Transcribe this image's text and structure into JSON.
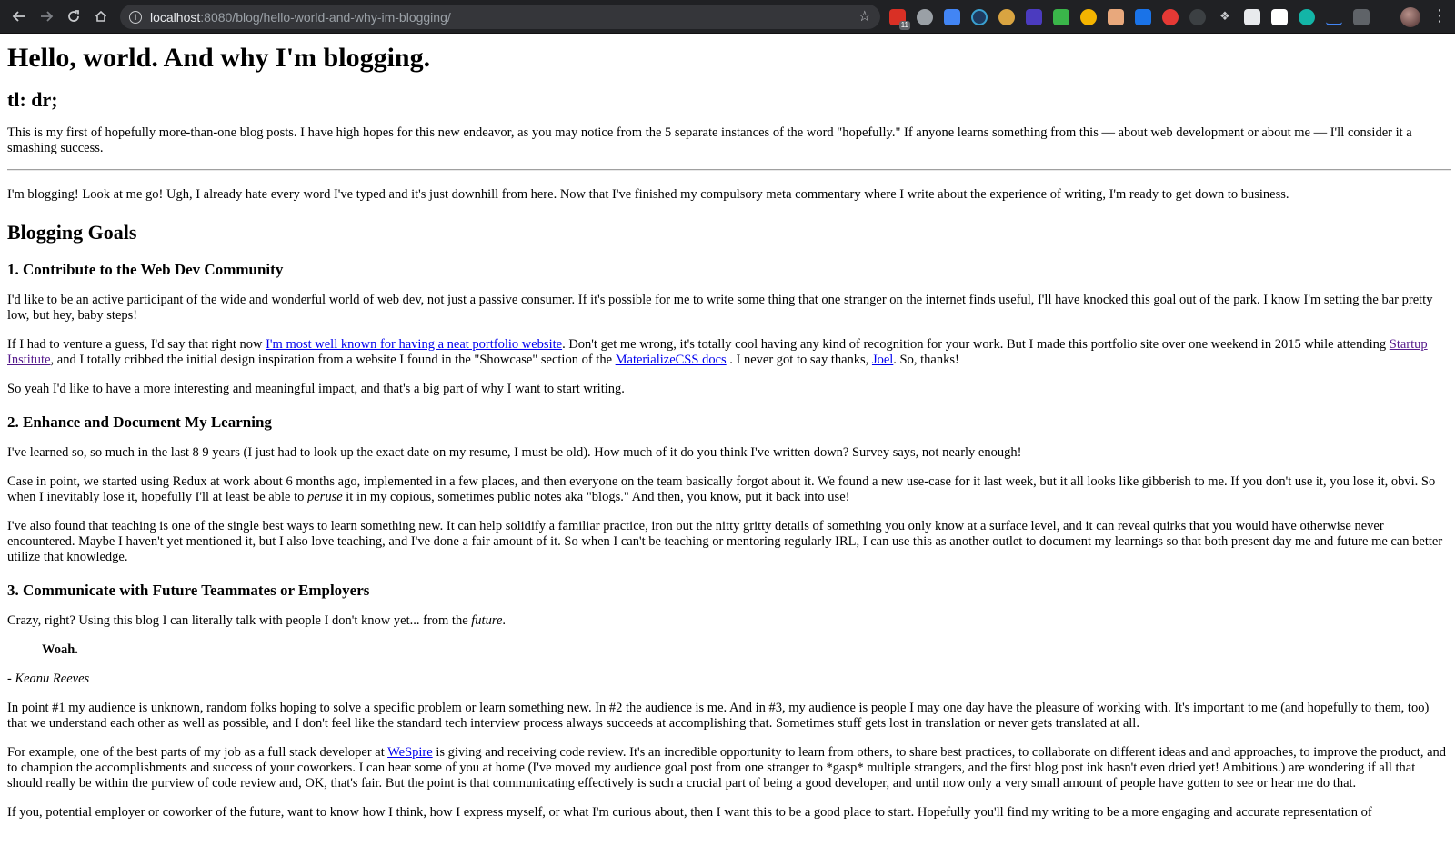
{
  "browser": {
    "url_host": "localhost",
    "url_rest": ":8080/blog/hello-world-and-why-im-blogging/",
    "extension_badge": "11"
  },
  "post": {
    "title": "Hello, world. And why I'm blogging.",
    "tldr_heading": "tl: dr;",
    "tldr_text": "This is my first of hopefully more-than-one blog posts. I have high hopes for this new endeavor, as you may notice from the 5 separate instances of the word \"hopefully.\" If anyone learns something from this — about web development or about me — I'll consider it a smashing success.",
    "intro": "I'm blogging! Look at me go! Ugh, I already hate every word I've typed and it's just downhill from here. Now that I've finished my compulsory meta commentary where I write about the experience of writing, I'm ready to get down to business.",
    "goals_heading": "Blogging Goals",
    "goal1": {
      "heading": "1. Contribute to the Web Dev Community",
      "p1": "I'd like to be an active participant of the wide and wonderful world of web dev, not just a passive consumer. If it's possible for me to write some thing that one stranger on the internet finds useful, I'll have knocked this goal out of the park. I know I'm setting the bar pretty low, but hey, baby steps!",
      "p2_a": "If I had to venture a guess, I'd say that right now ",
      "p2_link1": "I'm most well known for having a neat portfolio website",
      "p2_b": ". Don't get me wrong, it's totally cool having any kind of recognition for your work. But I made this portfolio site over one weekend in 2015 while attending ",
      "p2_link2": "Startup Institute",
      "p2_c": ", and I totally cribbed the initial design inspiration from a website I found in the \"Showcase\" section of the ",
      "p2_link3": "MaterializeCSS docs",
      "p2_d": " . I never got to say thanks, ",
      "p2_link4": "Joel",
      "p2_e": ". So, thanks!",
      "p3": "So yeah I'd like to have a more interesting and meaningful impact, and that's a big part of why I want to start writing."
    },
    "goal2": {
      "heading": "2. Enhance and Document My Learning",
      "p1": "I've learned so, so much in the last 8 9 years (I just had to look up the exact date on my resume, I must be old). How much of it do you think I've written down? Survey says, not nearly enough!",
      "p2_a": "Case in point, we started using Redux at work about 6 months ago, implemented in a few places, and then everyone on the team basically forgot about it. We found a new use-case for it last week, but it all looks like gibberish to me. If you don't use it, you lose it, obvi. So when I inevitably lose it, hopefully I'll at least be able to ",
      "p2_em": "peruse",
      "p2_b": " it in my copious, sometimes public notes aka \"blogs.\" And then, you know, put it back into use!",
      "p3": "I've also found that teaching is one of the single best ways to learn something new. It can help solidify a familiar practice, iron out the nitty gritty details of something you only know at a surface level, and it can reveal quirks that you would have otherwise never encountered. Maybe I haven't yet mentioned it, but I also love teaching, and I've done a fair amount of it. So when I can't be teaching or mentoring regularly IRL, I can use this as another outlet to document my learnings so that both present day me and future me can better utilize that knowledge."
    },
    "goal3": {
      "heading": "3. Communicate with Future Teammates or Employers",
      "p1_a": "Crazy, right? Using this blog I can literally talk with people I don't know yet... from the ",
      "p1_em": "future",
      "p1_b": ".",
      "quote": "Woah.",
      "cite": "- Keanu Reeves",
      "p2": "In point #1 my audience is unknown, random folks hoping to solve a specific problem or learn something new. In #2 the audience is me. And in #3, my audience is people I may one day have the pleasure of working with. It's important to me (and hopefully to them, too) that we understand each other as well as possible, and I don't feel like the standard tech interview process always succeeds at accomplishing that. Sometimes stuff gets lost in translation or never gets translated at all.",
      "p3_a": "For example, one of the best parts of my job as a full stack developer at ",
      "p3_link": "WeSpire",
      "p3_b": " is giving and receiving code review. It's an incredible opportunity to learn from others, to share best practices, to collaborate on different ideas and and approaches, to improve the product, and to champion the accomplishments and success of your coworkers. I can hear some of you at home (I've moved my audience goal post from one stranger to *gasp* multiple strangers, and the first blog post ink hasn't even dried yet! Ambitious.) are wondering if all that should really be within the purview of code review and, OK, that's fair. But the point is that communicating effectively is such a crucial part of being a good developer, and until now only a very small amount of people have gotten to see or hear me do that.",
      "p4": "If you, potential employer or coworker of the future, want to know how I think, how I express myself, or what I'm curious about, then I want this to be a good place to start. Hopefully you'll find my writing to be a more engaging and accurate representation of"
    }
  }
}
